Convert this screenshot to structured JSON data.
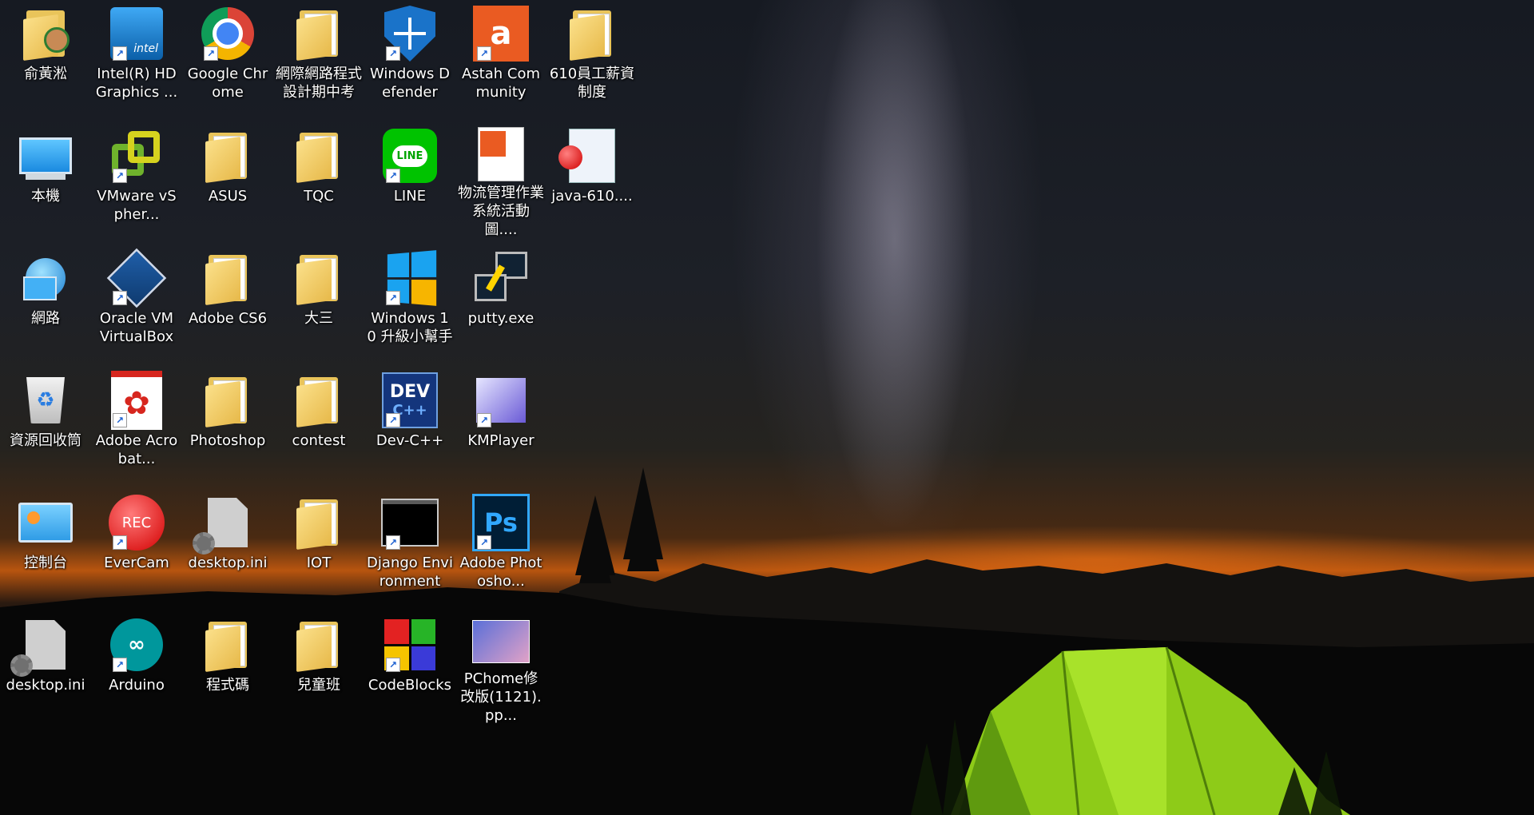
{
  "desktop": {
    "icons": [
      {
        "label": "俞黃淞",
        "icon": "user-folder-icon"
      },
      {
        "label": "Intel(R) HD Graphics ...",
        "icon": "intel-graphics-icon"
      },
      {
        "label": "Google Chrome",
        "icon": "chrome-icon"
      },
      {
        "label": "網際網路程式設計期中考",
        "icon": "folder-icon"
      },
      {
        "label": "Windows Defender",
        "icon": "windows-defender-icon"
      },
      {
        "label": "Astah Community",
        "icon": "astah-icon"
      },
      {
        "label": "610員工薪資制度",
        "icon": "folder-icon"
      },
      {
        "label": "本機",
        "icon": "this-pc-icon"
      },
      {
        "label": "VMware vSpher...",
        "icon": "vmware-icon"
      },
      {
        "label": "ASUS",
        "icon": "folder-icon"
      },
      {
        "label": "TQC",
        "icon": "folder-icon"
      },
      {
        "label": "LINE",
        "icon": "line-icon"
      },
      {
        "label": "物流管理作業系統活動圖....",
        "icon": "astah-file-icon"
      },
      {
        "label": "java-610....",
        "icon": "java-file-icon"
      },
      {
        "label": "網路",
        "icon": "network-icon"
      },
      {
        "label": "Oracle VM VirtualBox",
        "icon": "virtualbox-icon"
      },
      {
        "label": "Adobe CS6",
        "icon": "folder-icon"
      },
      {
        "label": "大三",
        "icon": "folder-icon"
      },
      {
        "label": "Windows 10 升級小幫手",
        "icon": "windows-icon"
      },
      {
        "label": "putty.exe",
        "icon": "putty-icon"
      },
      {
        "label": "資源回收筒",
        "icon": "recycle-bin-icon"
      },
      {
        "label": "Adobe Acrobat...",
        "icon": "acrobat-icon"
      },
      {
        "label": "Photoshop",
        "icon": "folder-icon"
      },
      {
        "label": "contest",
        "icon": "folder-icon"
      },
      {
        "label": "Dev-C++",
        "icon": "devcpp-icon"
      },
      {
        "label": "KMPlayer",
        "icon": "kmplayer-icon"
      },
      {
        "label": "控制台",
        "icon": "control-panel-icon"
      },
      {
        "label": "EverCam",
        "icon": "evercam-icon"
      },
      {
        "label": "desktop.ini",
        "icon": "settings-file-icon"
      },
      {
        "label": "IOT",
        "icon": "folder-icon"
      },
      {
        "label": "Django Environment",
        "icon": "terminal-icon"
      },
      {
        "label": "Adobe Photosho...",
        "icon": "photoshop-icon"
      },
      {
        "label": "desktop.ini",
        "icon": "settings-file-icon"
      },
      {
        "label": "Arduino",
        "icon": "arduino-icon"
      },
      {
        "label": "程式碼",
        "icon": "folder-icon"
      },
      {
        "label": "兒童班",
        "icon": "folder-icon"
      },
      {
        "label": "CodeBlocks",
        "icon": "codeblocks-icon"
      },
      {
        "label": "PChome修改版(1121).pp...",
        "icon": "powerpoint-file-icon"
      }
    ],
    "glyphs": {
      "ps": "Ps",
      "rec": "REC",
      "line": "LINE",
      "dev": "DEV",
      "cpp": "C++",
      "intel": "intel"
    }
  }
}
